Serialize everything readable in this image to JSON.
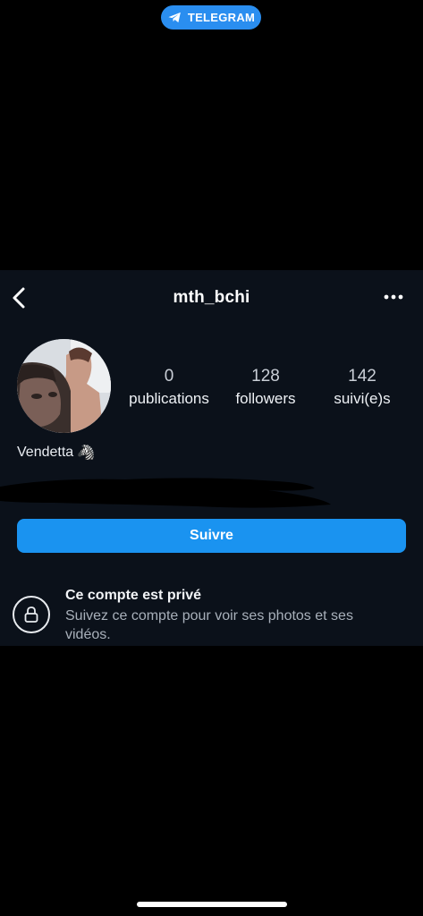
{
  "status_bar": {
    "telegram_label": "TELEGRAM"
  },
  "header": {
    "username": "mth_bchi",
    "back_icon": "chevron-left-icon",
    "more_icon": "more-horizontal-icon"
  },
  "profile": {
    "stats": [
      {
        "value": "0",
        "label": "publications"
      },
      {
        "value": "128",
        "label": "followers"
      },
      {
        "value": "142",
        "label": "suivi(e)s"
      }
    ],
    "bio_name": "Vendetta",
    "bio_emoji": "🦓"
  },
  "follow_button": {
    "label": "Suivre"
  },
  "private_notice": {
    "title": "Ce compte est privé",
    "text": "Suivez ce compte pour voir ses photos et ses vidéos.",
    "icon": "lock-icon"
  },
  "colors": {
    "accent": "#1a93f0",
    "panel_bg": "#0b111a",
    "telegram": "#2a8ef0"
  }
}
